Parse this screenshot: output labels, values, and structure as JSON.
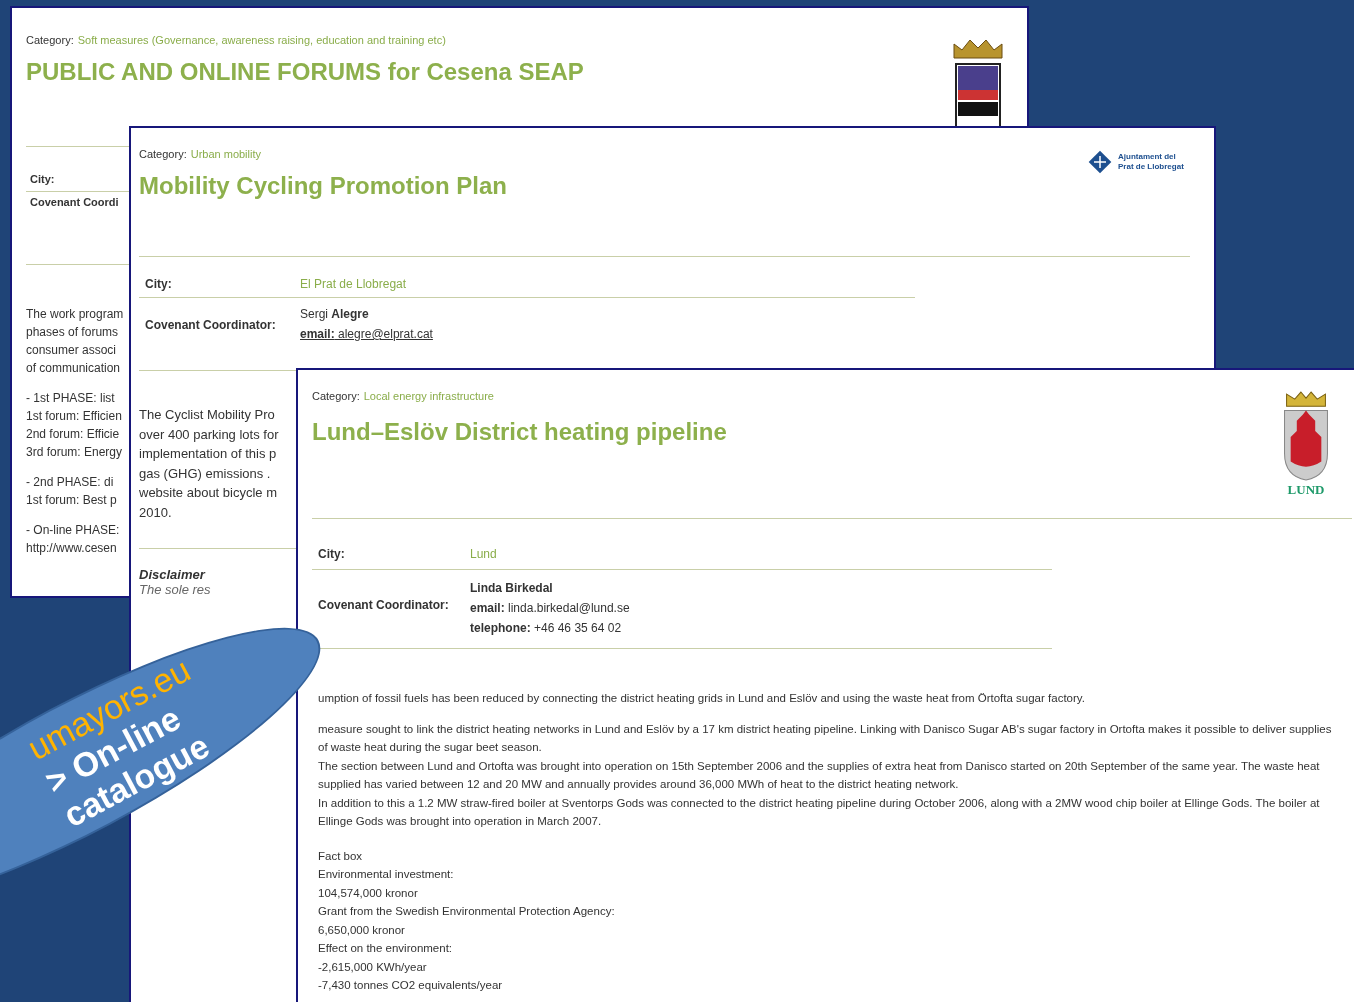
{
  "forum_page": {
    "category_label": "Category:",
    "category": "Soft measures (Governance, awareness raising, education and training etc)",
    "title": "PUBLIC AND ONLINE FORUMS for Cesena SEAP",
    "city_label": "City:",
    "coordinator_label": "Covenant Coordi",
    "text_lines": [
      "The work program",
      "phases of forums",
      "consumer associ",
      "of communication"
    ],
    "phase_groups": [
      [
        "- 1st PHASE: list",
        "1st forum: Efficien",
        "2nd forum: Efficie",
        "3rd forum: Energy"
      ],
      [
        "- 2nd PHASE: di",
        "1st forum: Best p"
      ],
      [
        "- On-line PHASE:",
        "http://www.cesen"
      ]
    ]
  },
  "mobility_page": {
    "category_label": "Category:",
    "category": "Urban mobility",
    "title": "Mobility Cycling Promotion Plan",
    "logo_text": "Ajuntament del Prat de Llobregat",
    "city_label": "City:",
    "city": "El Prat de Llobregat",
    "coordinator_label": "Covenant Coordinator:",
    "coordinator_first": "Sergi",
    "coordinator_last": "Alegre",
    "email_label": "email:",
    "email": "alegre@elprat.cat",
    "text_lines": [
      "The Cyclist Mobility Pro",
      "over 400 parking lots for",
      "implementation of this p",
      "gas (GHG) emissions .",
      "website about bicycle m",
      "2010."
    ],
    "disclaimer_title": "Disclaimer",
    "disclaimer_lines": [
      "The sole res"
    ]
  },
  "heating_page": {
    "category_label": "Category:",
    "category": "Local energy infrastructure",
    "title": "Lund–Eslöv District heating pipeline",
    "logo_text": "LUND",
    "city_label": "City:",
    "city": "Lund",
    "coordinator_label": "Covenant Coordinator:",
    "coordinator": "Linda Birkedal",
    "contacts": [
      {
        "label": "email:",
        "value": "linda.birkedal@lund.se"
      },
      {
        "label": "telephone:",
        "value": "+46 46 35 64 02"
      }
    ],
    "paragraphs": [
      "umption of fossil fuels has been reduced by connecting the district heating grids in Lund and Eslöv and using the waste heat from Örtofta sugar factory.",
      "measure sought to link the district heating networks in Lund and Eslöv by a 17 km district heating pipeline. Linking with Danisco Sugar AB's sugar factory in Ortofta makes it possible to deliver supplies of waste heat during the sugar beet season.\nThe section between Lund and Ortofta was brought into operation on 15th September 2006 and the supplies of extra heat from Danisco started on 20th September of the same year. The waste heat supplied has varied between 12 and 20 MW and annually provides around 36,000 MWh of heat to the district heating network.\nIn addition to this a 1.2 MW straw-fired boiler at Sventorps Gods was connected to the district heating pipeline during October 2006, along with a 2MW wood chip boiler at Ellinge Gods. The boiler at Ellinge Gods was brought into operation in March 2007."
    ],
    "fact_lines": [
      "Fact box",
      "Environmental investment:",
      "104,574,000 kronor",
      "Grant from the Swedish Environmental Protection Agency:",
      "6,650,000 kronor",
      "Effect on the environment:",
      "-2,615,000 KWh/year",
      "-7,430 tonnes CO2 equivalents/year"
    ]
  },
  "callout": {
    "lines": [
      {
        "text": "umayors.eu",
        "kind": "link"
      },
      {
        "text": "> On-line",
        "kind": "heading"
      },
      {
        "text": "catalogue",
        "kind": "heading"
      }
    ]
  }
}
